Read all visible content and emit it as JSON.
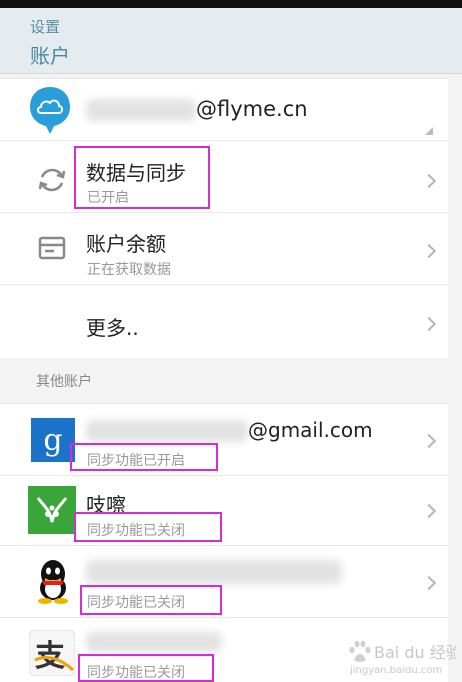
{
  "header": {
    "parent": "设置",
    "title": "账户"
  },
  "flyme": {
    "email_suffix": "@flyme.cn",
    "sync_label": "数据与同步",
    "sync_status": "已开启",
    "balance_label": "账户余额",
    "balance_status": "正在获取数据",
    "more_label": "更多.."
  },
  "other_section_label": "其他账户",
  "other_accounts": [
    {
      "name": "@gmail.com",
      "status": "同步功能已开启",
      "icon": "google-icon"
    },
    {
      "name": "吱嚓",
      "status": "同步功能已关闭",
      "icon": "zhaji-icon"
    },
    {
      "name": "",
      "status": "同步功能已关闭",
      "icon": "qq-icon"
    },
    {
      "name": "",
      "status": "同步功能已关闭",
      "icon": "alipay-icon"
    }
  ],
  "watermark": "Bai du 经验",
  "watermark_url": "jingyan.baidu.com",
  "colors": {
    "accent": "#4a87a3",
    "highlight": "#d62bd6",
    "google_blue": "#1a73c8",
    "zhaji_green": "#3aa63a"
  }
}
